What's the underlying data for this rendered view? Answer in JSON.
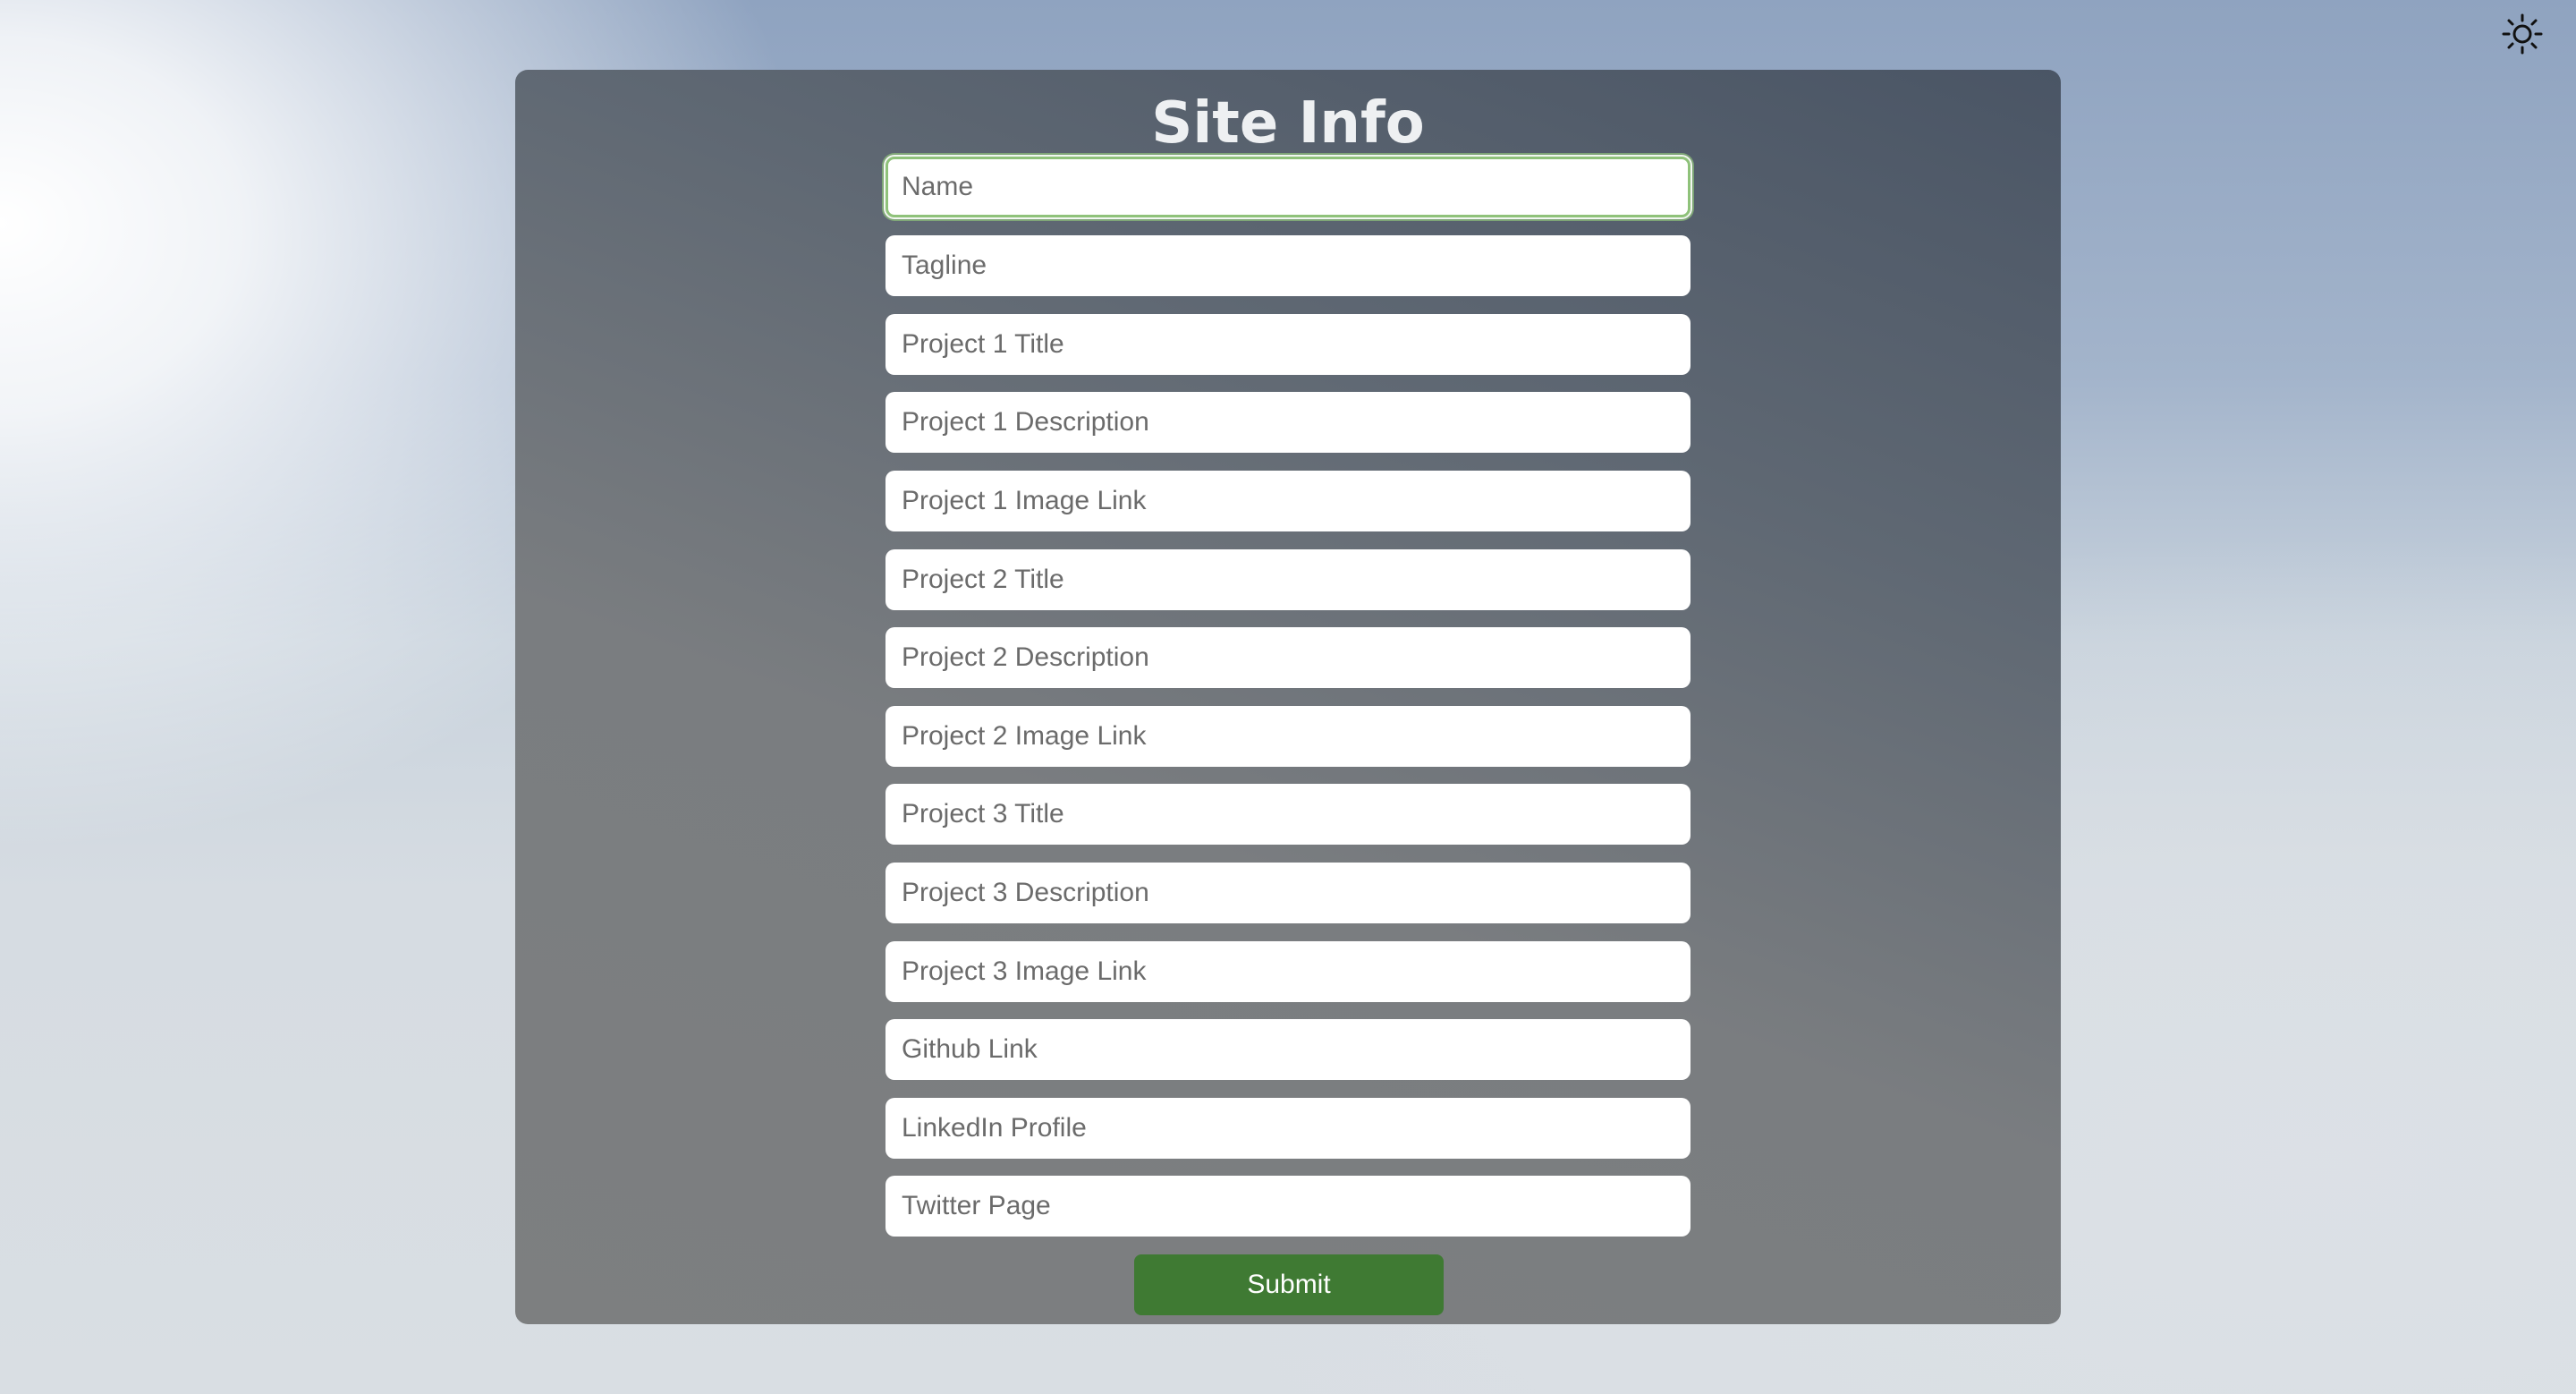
{
  "header": {
    "theme_toggle_icon": "sun-icon"
  },
  "form": {
    "title": "Site Info",
    "fields": [
      {
        "name": "name-field",
        "placeholder": "Name"
      },
      {
        "name": "tagline-field",
        "placeholder": "Tagline"
      },
      {
        "name": "project-1-title-field",
        "placeholder": "Project 1 Title"
      },
      {
        "name": "project-1-description-field",
        "placeholder": "Project 1 Description"
      },
      {
        "name": "project-1-image-link-field",
        "placeholder": "Project 1 Image Link"
      },
      {
        "name": "project-2-title-field",
        "placeholder": "Project 2 Title"
      },
      {
        "name": "project-2-description-field",
        "placeholder": "Project 2 Description"
      },
      {
        "name": "project-2-image-link-field",
        "placeholder": "Project 2 Image Link"
      },
      {
        "name": "project-3-title-field",
        "placeholder": "Project 3 Title"
      },
      {
        "name": "project-3-description-field",
        "placeholder": "Project 3 Description"
      },
      {
        "name": "project-3-image-link-field",
        "placeholder": "Project 3 Image Link"
      },
      {
        "name": "github-link-field",
        "placeholder": "Github Link"
      },
      {
        "name": "linkedin-profile-field",
        "placeholder": "LinkedIn Profile"
      },
      {
        "name": "twitter-page-field",
        "placeholder": "Twitter Page"
      }
    ],
    "submit_label": "Submit"
  },
  "colors": {
    "submit": "#3f7a33",
    "focus_ring": "#8fc27a",
    "card": "#6b7078"
  }
}
